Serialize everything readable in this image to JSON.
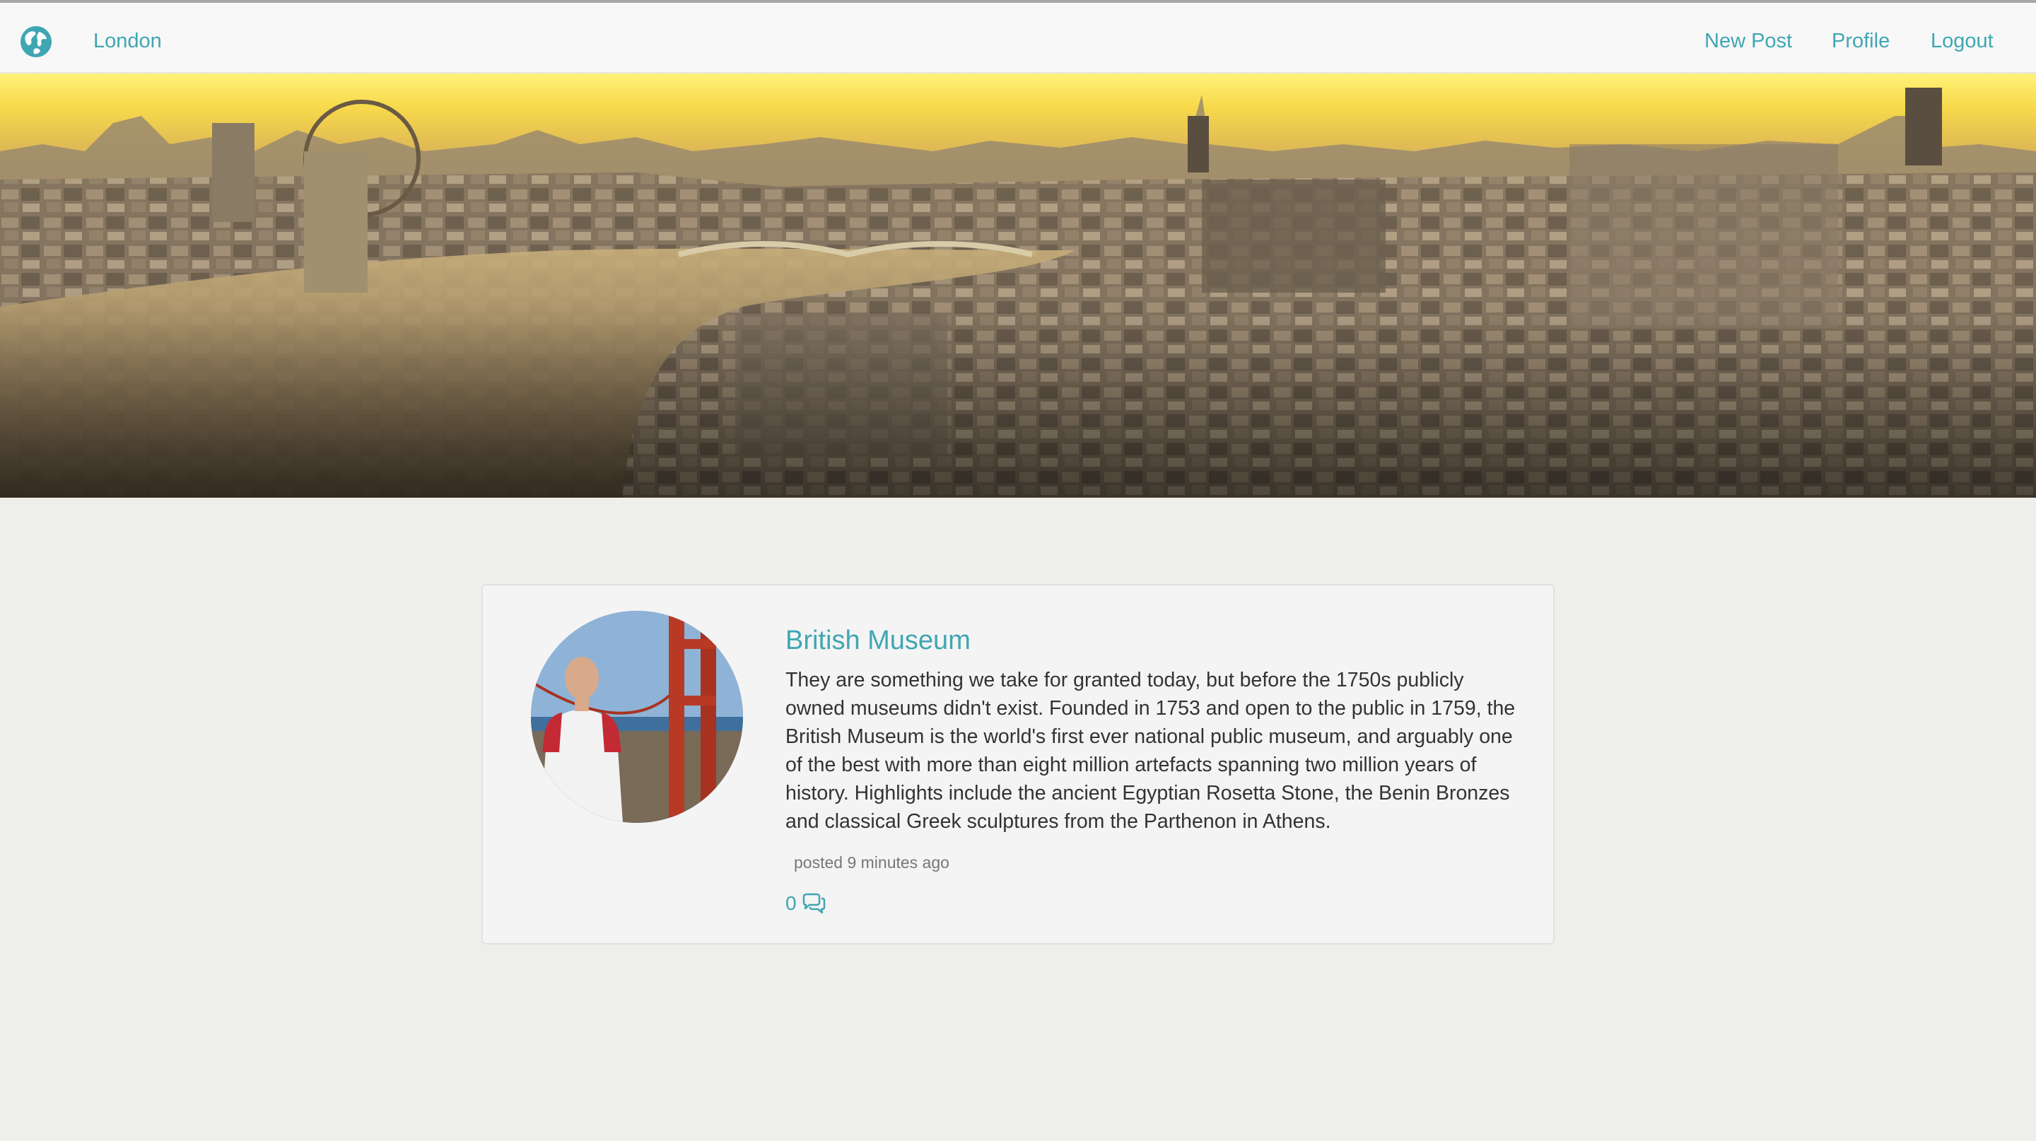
{
  "navbar": {
    "brand_label": "London",
    "brand_icon": "globe-icon",
    "links": {
      "new_post": "New Post",
      "profile": "Profile",
      "logout": "Logout"
    }
  },
  "hero": {
    "image": "london-skyline-panorama"
  },
  "post": {
    "title": "British Museum",
    "body": "They are something we take for granted today, but before the 1750s publicly owned museums didn't exist. Founded in 1753 and open to the public in 1759, the British Museum is the world's first ever national public museum, and arguably one of the best with more than eight million artefacts spanning two million years of history. Highlights include the ancient Egyptian Rosetta Stone, the Benin Bronzes and classical Greek sculptures from the Parthenon in Athens.",
    "posted": "posted 9 minutes ago",
    "comment_count": "0",
    "comment_icon": "comments-icon",
    "avatar": "user-avatar-golden-gate"
  },
  "colors": {
    "accent": "#3fa6b3",
    "background": "#eeeeeb",
    "navbar": "#f8f8f8",
    "card": "#f4f4f4",
    "text": "#333333",
    "muted": "#777777"
  }
}
